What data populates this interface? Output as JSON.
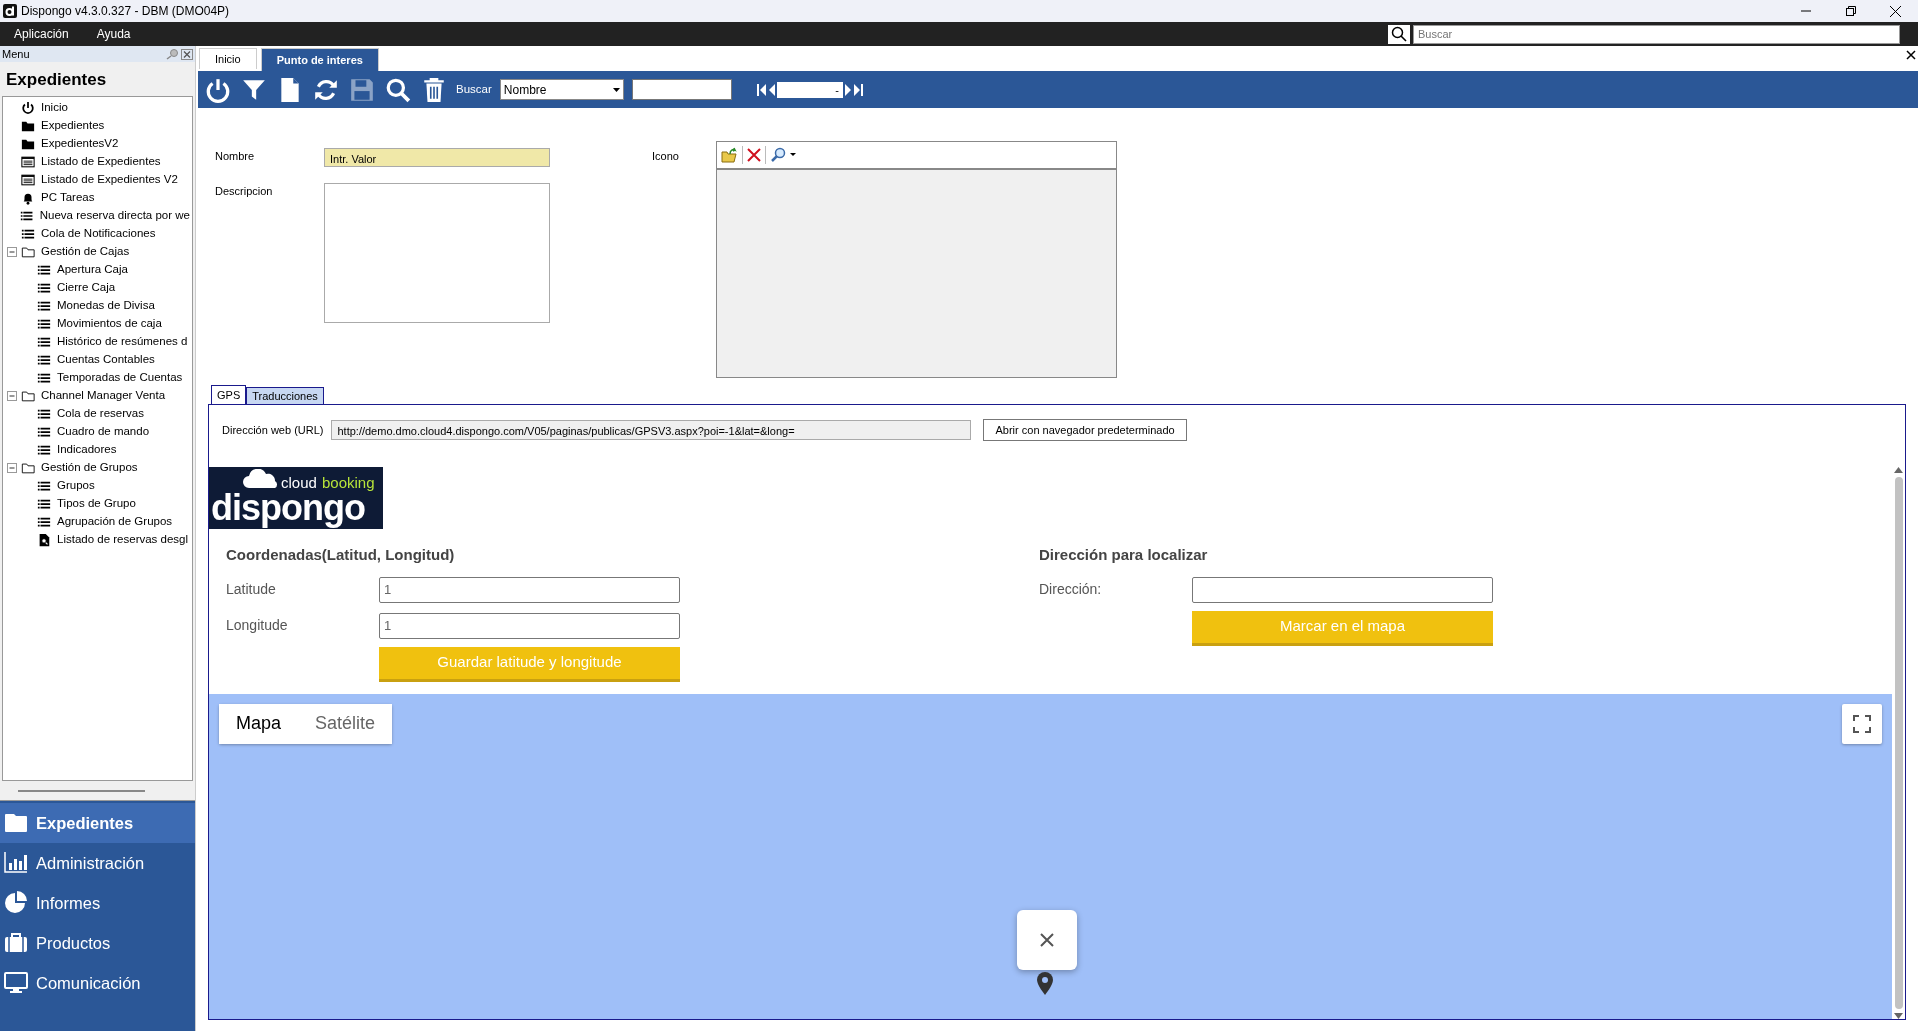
{
  "window": {
    "title": "Dispongo v4.3.0.327 - DBM (DMO04P)"
  },
  "menu_bar": {
    "items": [
      "Aplicación",
      "Ayuda"
    ],
    "search": {
      "placeholder": "Buscar"
    }
  },
  "sidebar": {
    "panel_title": "Menu",
    "heading": "Expedientes",
    "tree": [
      {
        "label": "Inicio",
        "kind": "power"
      },
      {
        "label": "Expedientes",
        "kind": "folder"
      },
      {
        "label": "ExpedientesV2",
        "kind": "folder"
      },
      {
        "label": "Listado de Expedientes",
        "kind": "form"
      },
      {
        "label": "Listado de Expedientes V2",
        "kind": "form"
      },
      {
        "label": "PC Tareas",
        "kind": "bell"
      },
      {
        "label": "Nueva reserva directa por we",
        "kind": "list"
      },
      {
        "label": "Cola de Notificaciones",
        "kind": "list"
      },
      {
        "label": "Gestión de Cajas",
        "kind": "group",
        "expanded": true,
        "children": [
          {
            "label": "Apertura Caja",
            "kind": "list"
          },
          {
            "label": "Cierre Caja",
            "kind": "list"
          },
          {
            "label": "Monedas de Divisa",
            "kind": "list"
          },
          {
            "label": "Movimientos de caja",
            "kind": "list"
          },
          {
            "label": "Histórico de resúmenes d",
            "kind": "list"
          },
          {
            "label": "Cuentas Contables",
            "kind": "list"
          },
          {
            "label": "Temporadas de Cuentas",
            "kind": "list"
          }
        ]
      },
      {
        "label": "Channel Manager Venta",
        "kind": "group",
        "expanded": true,
        "children": [
          {
            "label": "Cola de reservas",
            "kind": "list"
          },
          {
            "label": "Cuadro de mando",
            "kind": "list"
          },
          {
            "label": "Indicadores",
            "kind": "list"
          }
        ]
      },
      {
        "label": "Gestión de Grupos",
        "kind": "group",
        "expanded": true,
        "children": [
          {
            "label": "Grupos",
            "kind": "list"
          },
          {
            "label": "Tipos de Grupo",
            "kind": "list"
          },
          {
            "label": "Agrupación de Grupos",
            "kind": "list"
          },
          {
            "label": "Listado de reservas desgl",
            "kind": "search-doc"
          }
        ]
      }
    ],
    "modules": [
      {
        "label": "Expedientes",
        "kind": "folder",
        "selected": true
      },
      {
        "label": "Administración",
        "kind": "chart",
        "selected": false
      },
      {
        "label": "Informes",
        "kind": "pie",
        "selected": false
      },
      {
        "label": "Productos",
        "kind": "case",
        "selected": false
      },
      {
        "label": "Comunicación",
        "kind": "monitor",
        "selected": false
      }
    ]
  },
  "doc_tabs": [
    {
      "label": "Inicio",
      "selected": false
    },
    {
      "label": "Punto de interes",
      "selected": true
    }
  ],
  "toolbar": {
    "buttons": [
      {
        "kind": "power",
        "disabled": false
      },
      {
        "kind": "filter",
        "disabled": false
      },
      {
        "kind": "new",
        "disabled": false
      },
      {
        "kind": "refresh",
        "disabled": false
      },
      {
        "kind": "save",
        "disabled": true
      },
      {
        "kind": "search",
        "disabled": false
      },
      {
        "kind": "delete",
        "disabled": false
      }
    ],
    "search_label": "Buscar",
    "search_field": "Nombre",
    "record": "-"
  },
  "form": {
    "name_label": "Nombre",
    "name_value": "Intr. Valor",
    "description_label": "Descripcion",
    "icon_label": "Icono"
  },
  "detail_tabs": [
    {
      "label": "GPS",
      "selected": true
    },
    {
      "label": "Traducciones",
      "selected": false
    }
  ],
  "gps": {
    "url_label": "Dirección web (URL)",
    "url": "http://demo.dmo.cloud4.dispongo.com/V05/paginas/publicas/GPSV3.aspx?poi=-1&lat=&long=",
    "open_button": "Abrir con navegador predeterminado",
    "logo": {
      "small_left": "cloud",
      "small_right": "booking",
      "main": "dispongo"
    },
    "coordinates": {
      "heading": "Coordenadas(Latitud, Longitud)",
      "latitude_label": "Latitude",
      "latitude": "1",
      "longitude_label": "Longitude",
      "longitude": "1",
      "save_button": "Guardar latitude y longitude"
    },
    "address": {
      "heading": "Dirección para localizar",
      "label": "Dirección:",
      "button": "Marcar en el mapa"
    },
    "map": {
      "tabs": [
        {
          "label": "Mapa",
          "selected": true
        },
        {
          "label": "Satélite",
          "selected": false
        }
      ]
    }
  }
}
